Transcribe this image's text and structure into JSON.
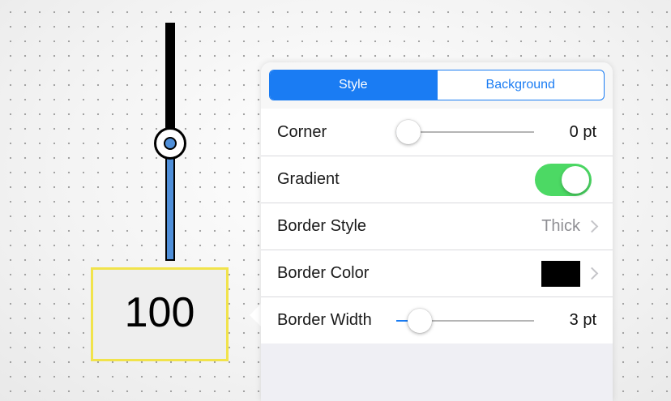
{
  "canvas": {
    "value_box_text": "100",
    "vertical_slider_level": 0.51,
    "slider_fill_color": "#4f8fd9",
    "selection_outline_color": "#f1e34b"
  },
  "popover": {
    "tabs": [
      {
        "label": "Style",
        "selected": true
      },
      {
        "label": "Background",
        "selected": false
      }
    ],
    "accent_color": "#1a7cf3",
    "rows": {
      "corner": {
        "label": "Corner",
        "value": "0 pt",
        "slider_level": 0.0
      },
      "gradient": {
        "label": "Gradient",
        "on": true,
        "toggle_color": "#4cd964"
      },
      "border_style": {
        "label": "Border Style",
        "value": "Thick",
        "icon": "chevron-right-icon"
      },
      "border_color": {
        "label": "Border Color",
        "swatch_color": "#000000",
        "icon": "chevron-right-icon"
      },
      "border_width": {
        "label": "Border Width",
        "value": "3 pt",
        "slider_level": 0.1
      }
    }
  }
}
